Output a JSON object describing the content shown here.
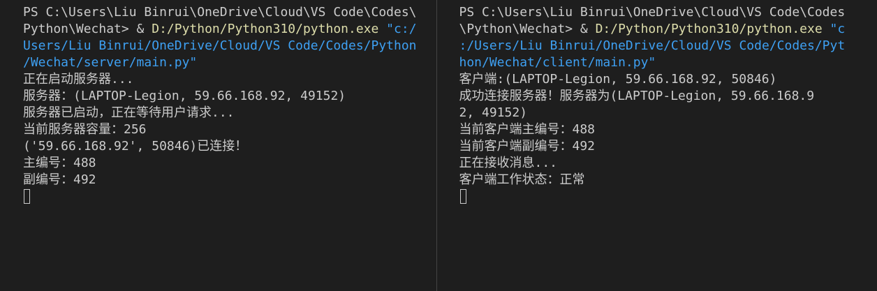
{
  "colors": {
    "background": "#1e1e1e",
    "text": "#cccccc",
    "executable": "#dcdcaa",
    "path": "#3ea0f2",
    "divider": "#444444"
  },
  "panes": [
    {
      "name": "server",
      "lines": [
        [
          {
            "t": "PS C:\\Users\\Liu Binrui\\OneDrive\\Cloud\\VS Code\\Codes\\",
            "c": "text"
          }
        ],
        [
          {
            "t": "Python\\Wechat> & ",
            "c": "text"
          },
          {
            "t": "D:/Python/Python310/python.exe",
            "c": "exe"
          },
          {
            "t": " \"c:/",
            "c": "path"
          }
        ],
        [
          {
            "t": "Users/Liu Binrui/OneDrive/Cloud/VS Code/Codes/Python",
            "c": "path"
          }
        ],
        [
          {
            "t": "/Wechat/server/main.py\"",
            "c": "path"
          }
        ],
        [
          {
            "t": "正在启动服务器...",
            "c": "text"
          }
        ],
        [
          {
            "t": "服务器：(LAPTOP-Legion, 59.66.168.92, 49152)",
            "c": "text"
          }
        ],
        [
          {
            "t": "服务器已启动，正在等待用户请求...",
            "c": "text"
          }
        ],
        [
          {
            "t": "当前服务器容量：256",
            "c": "text"
          }
        ],
        [
          {
            "t": "('59.66.168.92', 50846)已连接！",
            "c": "text"
          }
        ],
        [
          {
            "t": "主编号：488",
            "c": "text"
          }
        ],
        [
          {
            "t": "副编号：492",
            "c": "text"
          }
        ]
      ]
    },
    {
      "name": "client",
      "lines": [
        [
          {
            "t": "PS C:\\Users\\Liu Binrui\\OneDrive\\Cloud\\VS Code\\Codes",
            "c": "text"
          }
        ],
        [
          {
            "t": "\\Python\\Wechat> & ",
            "c": "text"
          },
          {
            "t": "D:/Python/Python310/python.exe",
            "c": "exe"
          },
          {
            "t": " \"c",
            "c": "path"
          }
        ],
        [
          {
            "t": ":/Users/Liu Binrui/OneDrive/Cloud/VS Code/Codes/Pyt",
            "c": "path"
          }
        ],
        [
          {
            "t": "hon/Wechat/client/main.py\"",
            "c": "path"
          }
        ],
        [
          {
            "t": "客户端:(LAPTOP-Legion, 59.66.168.92, 50846)",
            "c": "text"
          }
        ],
        [
          {
            "t": "成功连接服务器！服务器为(LAPTOP-Legion, 59.66.168.9",
            "c": "text"
          }
        ],
        [
          {
            "t": "2, 49152)",
            "c": "text"
          }
        ],
        [
          {
            "t": "当前客户端主编号：488",
            "c": "text"
          }
        ],
        [
          {
            "t": "当前客户端副编号：492",
            "c": "text"
          }
        ],
        [
          {
            "t": "正在接收消息...",
            "c": "text"
          }
        ],
        [
          {
            "t": "客户端工作状态：正常",
            "c": "text"
          }
        ]
      ]
    }
  ]
}
